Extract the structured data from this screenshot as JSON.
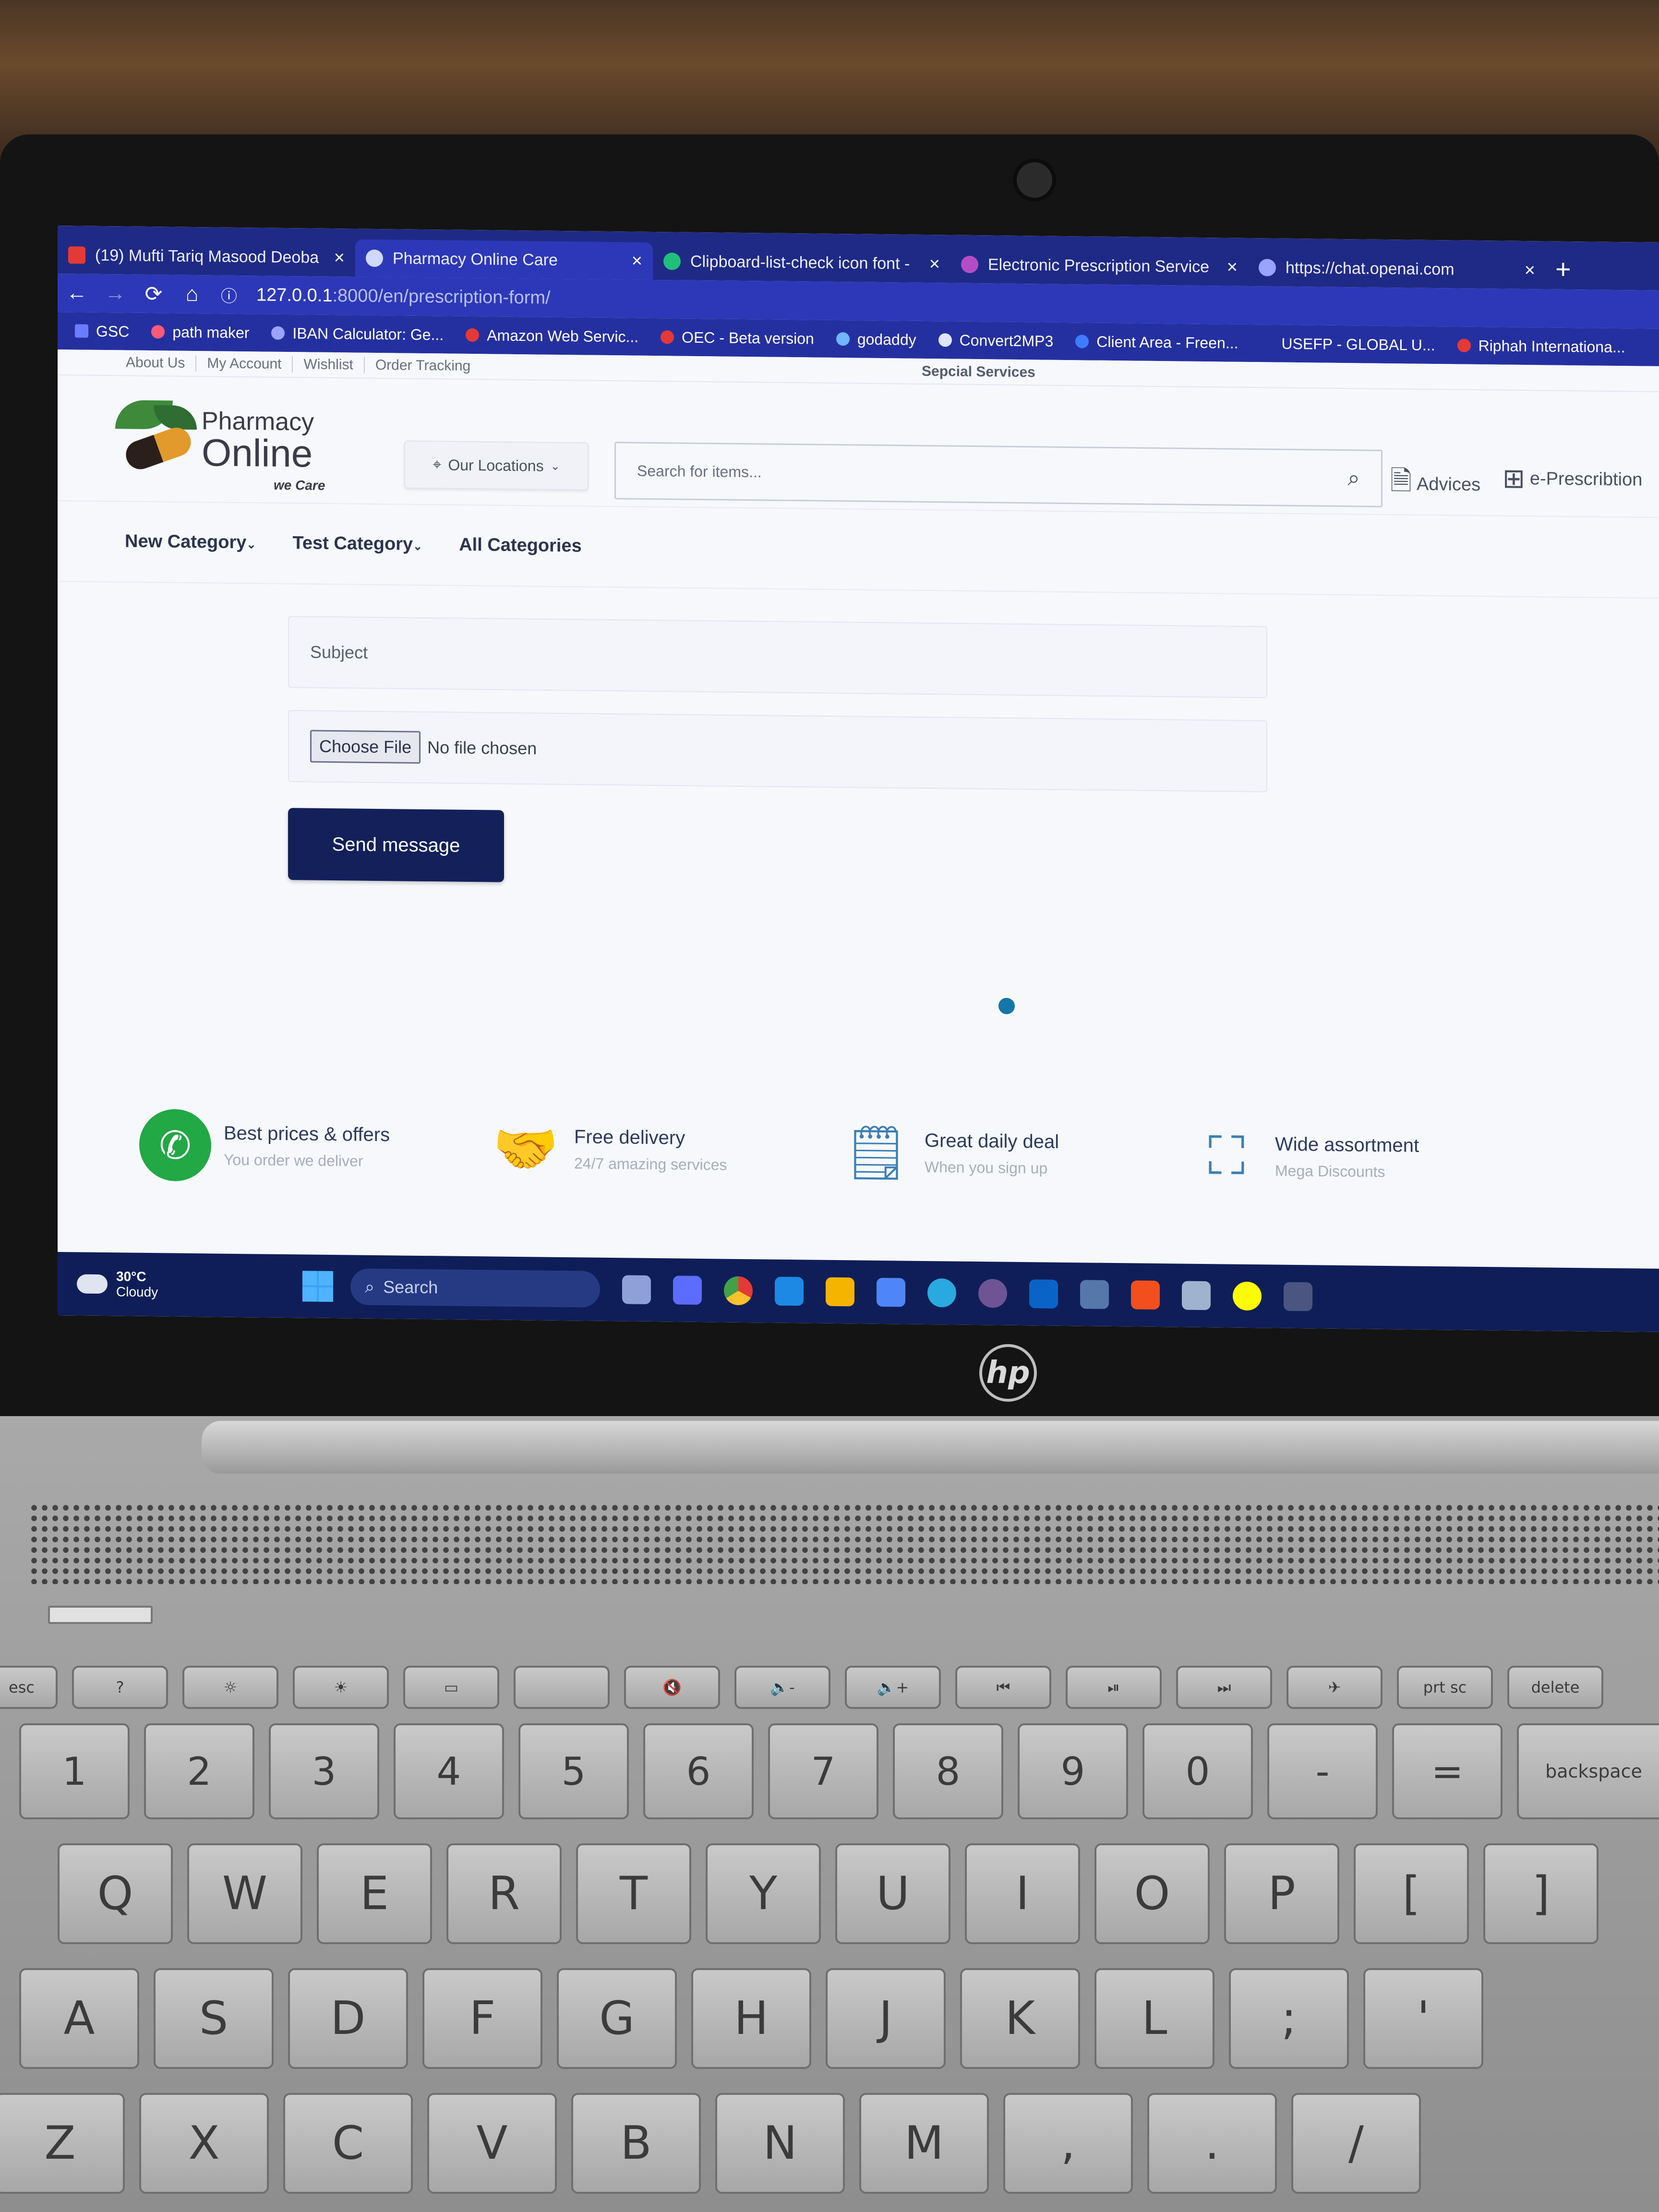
{
  "browser": {
    "tabs": [
      {
        "label": "(19) Mufti Tariq Masood Deoba",
        "icon_color": "#e53935",
        "active": false
      },
      {
        "label": "Pharmacy Online Care",
        "icon_color": "#cfd8ff",
        "active": true
      },
      {
        "label": "Clipboard-list-check icon font -",
        "icon_color": "#21c07a",
        "active": false
      },
      {
        "label": "Electronic Prescription Service",
        "icon_color": "#b44cc7",
        "active": false
      },
      {
        "label": "https://chat.openai.com",
        "icon_color": "#9aa3ff",
        "active": false
      }
    ],
    "close_glyph": "×",
    "new_tab_glyph": "+",
    "url_host": "127.0.0.1",
    "url_rest": ":8000/en/prescription-form/",
    "bookmarks": [
      {
        "label": "GSC",
        "icon_color": "#6b7cff"
      },
      {
        "label": "path maker",
        "icon_color": "#ff5a7a"
      },
      {
        "label": "IBAN Calculator: Ge...",
        "icon_color": "#9aa3ff"
      },
      {
        "label": "Amazon Web Servic...",
        "icon_color": "#e53935"
      },
      {
        "label": "OEC - Beta version",
        "icon_color": "#e53935"
      },
      {
        "label": "godaddy",
        "icon_color": "#6fb6ff"
      },
      {
        "label": "Convert2MP3",
        "icon_color": "#dfe4ff"
      },
      {
        "label": "Client Area - Freen...",
        "icon_color": "#3f7bff"
      },
      {
        "label": "USEFP - GLOBAL U...",
        "icon_color": "#2530a0"
      },
      {
        "label": "Riphah Internationa...",
        "icon_color": "#e53935"
      }
    ]
  },
  "page": {
    "top_links": [
      "About Us",
      "My Account",
      "Wishlist",
      "Order Tracking"
    ],
    "special_services": "Sepcial Services",
    "logo": {
      "line1": "Pharmacy",
      "line2": "Online",
      "tagline": "we Care"
    },
    "locations_button": "Our Locations",
    "search_placeholder": "Search for items...",
    "advices_label": "Advices",
    "eprescription_label": "e-Prescribtion",
    "categories": [
      "New Category",
      "Test Category",
      "All Categories"
    ],
    "form": {
      "subject_placeholder": "Subject",
      "choose_file_label": "Choose File",
      "no_file_text": "No file chosen",
      "send_label": "Send message"
    },
    "features": [
      {
        "title": "Best prices & offers",
        "subtitle": "You order we deliver",
        "icon": "whatsapp-icon"
      },
      {
        "title": "Free delivery",
        "subtitle": "24/7 amazing services",
        "icon": "delivery-handshake-icon"
      },
      {
        "title": "Great daily deal",
        "subtitle": "When you sign up",
        "icon": "document-dollar-icon"
      },
      {
        "title": "Wide assortment",
        "subtitle": "Mega Discounts",
        "icon": "assortment-icon"
      }
    ]
  },
  "taskbar": {
    "temperature": "30°C",
    "weather": "Cloudy",
    "search_label": "Search"
  },
  "keyboard": {
    "function_row": [
      "esc",
      "?",
      "☼",
      "☀",
      "▭",
      "",
      "🔇",
      "🔈-",
      "🔈+",
      "⏮",
      "⏯",
      "⏭",
      "✈",
      "prt sc",
      "delete"
    ],
    "number_row": [
      "1",
      "2",
      "3",
      "4",
      "5",
      "6",
      "7",
      "8",
      "9",
      "0",
      "-",
      "=",
      "backspace"
    ],
    "number_row_shift": [
      "!",
      "@",
      "#",
      "$",
      "%",
      "^",
      "&",
      "*",
      "(",
      ")",
      "_",
      "+",
      ""
    ],
    "qwerty_row": [
      "Q",
      "W",
      "E",
      "R",
      "T",
      "Y",
      "U",
      "I",
      "O",
      "P",
      "[",
      "]"
    ],
    "asdf_row": [
      "A",
      "S",
      "D",
      "F",
      "G",
      "H",
      "J",
      "K",
      "L",
      ";",
      "'"
    ],
    "zxcv_row": [
      "Z",
      "X",
      "C",
      "V",
      "B",
      "N",
      "M",
      ",",
      ".",
      "/"
    ]
  },
  "colors": {
    "tab_bar": "#1f2a86",
    "active_tab": "#2d38b8",
    "send_button": "#142059",
    "taskbar": "#0f1e58"
  }
}
